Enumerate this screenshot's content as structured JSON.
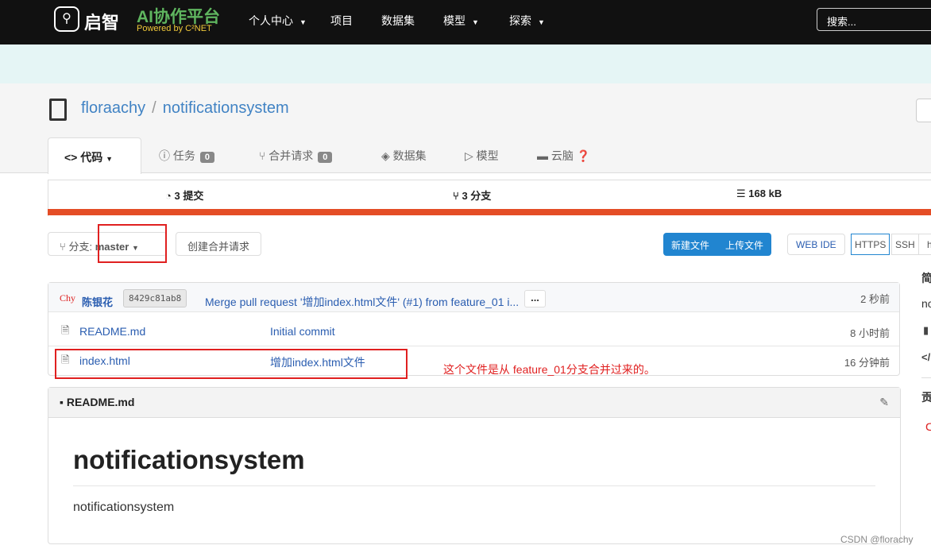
{
  "header": {
    "brand": "启智",
    "platform": "AI协作平台",
    "powered": "Powered by C²NET",
    "nav": [
      "个人中心",
      "项目",
      "数据集",
      "模型",
      "探索"
    ],
    "search_placeholder": "搜索..."
  },
  "repo": {
    "owner": "floraachy",
    "separator": "/",
    "name": "notificationsystem"
  },
  "tabs": [
    {
      "label": "代码"
    },
    {
      "label": "任务",
      "count": "0"
    },
    {
      "label": "合并请求",
      "count": "0"
    },
    {
      "label": "数据集"
    },
    {
      "label": "模型"
    },
    {
      "label": "云脑"
    }
  ],
  "stats": {
    "commits": "3 提交",
    "branches": "3 分支",
    "size": "168 kB",
    "bar_color": "#e44d26"
  },
  "toolbar": {
    "branch_label": "分支:",
    "branch": "master",
    "create_pr": "创建合并请求",
    "new_file": "新建文件",
    "upload_file": "上传文件",
    "web_ide": "WEB IDE",
    "https": "HTTPS",
    "ssh": "SSH",
    "extra": "h"
  },
  "latest_commit": {
    "avatar": "Chy",
    "author": "陈银花",
    "sha": "8429c81ab8",
    "message": "Merge pull request '增加index.html文件' (#1) from feature_01 i...",
    "more": "...",
    "time": "2 秒前"
  },
  "files": [
    {
      "name": "README.md",
      "commit": "Initial commit",
      "time": "8 小时前"
    },
    {
      "name": "index.html",
      "commit": "增加index.html文件",
      "time": "16 分钟前"
    }
  ],
  "annotation": "这个文件是从 feature_01分支合并过来的。",
  "readme": {
    "filename": "README.md",
    "heading": "notificationsystem",
    "body": "notificationsystem"
  },
  "sidebar": {
    "intro": "简",
    "desc": "nc",
    "contrib": "贡"
  },
  "watermark": "CSDN @florachy"
}
